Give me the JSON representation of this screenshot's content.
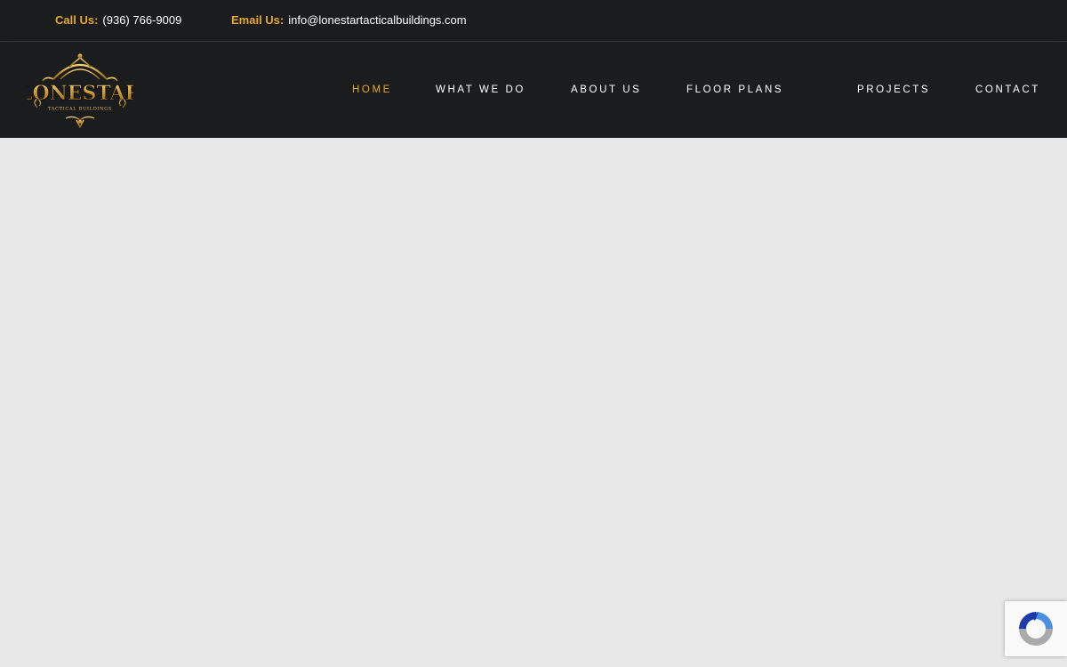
{
  "topbar": {
    "call_label": "Call Us:",
    "phone": "(936) 766-9009",
    "email_label": "Email Us:",
    "email": "info@lonestartacticalbuildings.com"
  },
  "logo": {
    "brand_main": "LONESTAR",
    "brand_sub": "TACTICAL BUILDINGS"
  },
  "nav": {
    "items": [
      {
        "label": "HOME",
        "active": true
      },
      {
        "label": "WHAT WE DO",
        "active": false
      },
      {
        "label": "ABOUT US",
        "active": false
      },
      {
        "label": "FLOOR PLANS",
        "active": false
      },
      {
        "label": "PROJECTS",
        "active": false
      },
      {
        "label": "CONTACT",
        "active": false
      }
    ]
  },
  "colors": {
    "accent": "#e8a628",
    "header_bg": "#1b1c1e",
    "content_bg": "#e8e8e8"
  },
  "icons": {
    "recaptcha": "recaptcha-icon"
  }
}
